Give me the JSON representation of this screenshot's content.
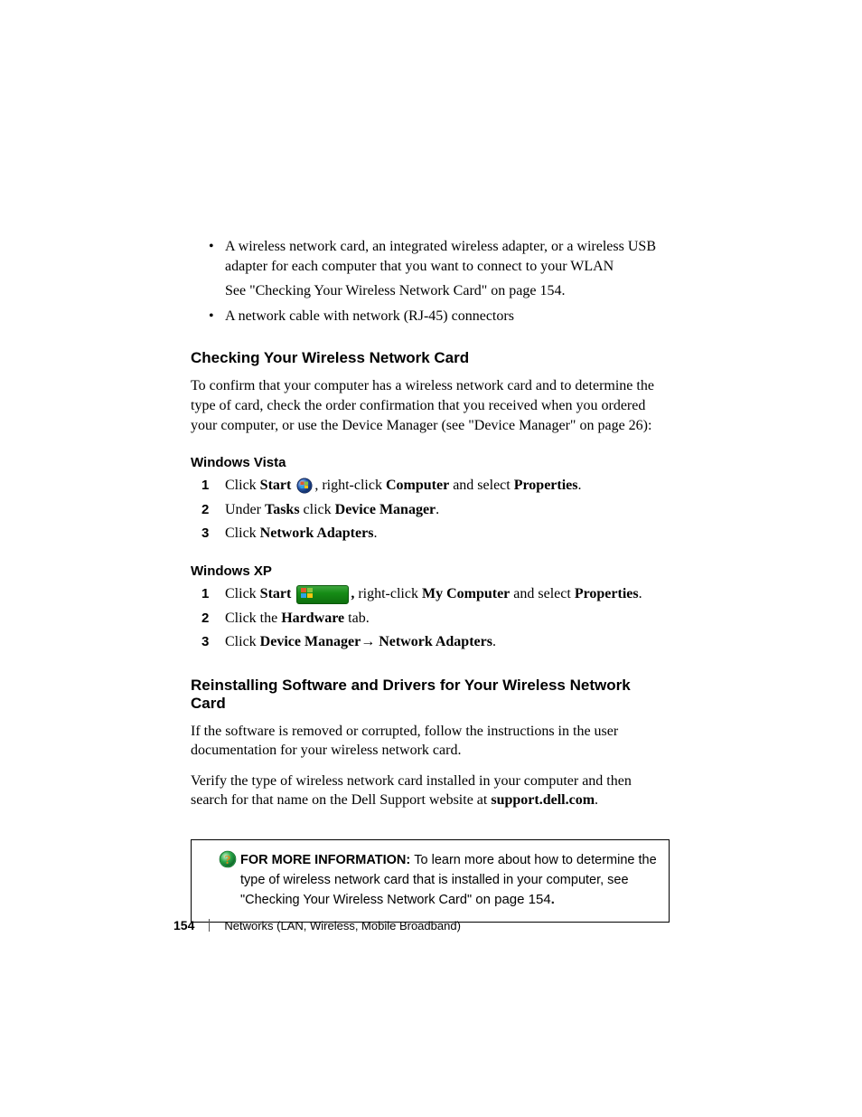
{
  "bullets": {
    "b1": "A wireless network card, an integrated wireless adapter, or a wireless USB adapter for each computer that you want to connect to your WLAN",
    "b1_sub": "See \"Checking Your Wireless Network Card\" on page 154.",
    "b2": "A network cable with network (RJ-45) connectors"
  },
  "section1": {
    "title": "Checking Your Wireless Network Card",
    "body": "To confirm that your computer has a wireless network card and to determine the type of card, check the order confirmation that you received when you ordered your computer, or use the Device Manager (see \"Device Manager\" on page 26):"
  },
  "vista": {
    "title": "Windows Vista",
    "steps": {
      "s1": {
        "num": "1",
        "pre": "Click ",
        "word_start": "Start ",
        "mid": ", right-click ",
        "word_comp": "Computer",
        "mid2": " and select ",
        "word_prop": "Properties",
        "end": "."
      },
      "s2": {
        "num": "2",
        "pre": "Under ",
        "word_tasks": "Tasks",
        "mid": " click ",
        "word_dm": "Device Manager",
        "end": "."
      },
      "s3": {
        "num": "3",
        "pre": "Click ",
        "word_na": "Network Adapters",
        "end": "."
      }
    }
  },
  "xp": {
    "title": "Windows XP",
    "steps": {
      "s1": {
        "num": "1",
        "pre": "Click ",
        "word_start": "Start ",
        "comma": ", ",
        "mid": "right-click ",
        "word_comp": "My Computer",
        "mid2": " and select ",
        "word_prop": "Properties",
        "end": "."
      },
      "s2": {
        "num": "2",
        "pre": "Click the ",
        "word_hw": "Hardware",
        "end": " tab."
      },
      "s3": {
        "num": "3",
        "pre": "Click ",
        "word_dm": "Device Manager",
        "arrow": "→ ",
        "word_na": "Network Adapters",
        "end": "."
      }
    }
  },
  "section2": {
    "title": "Reinstalling Software and Drivers for Your Wireless Network Card",
    "body1": "If the software is removed or corrupted, follow the instructions in the user documentation for your wireless network card.",
    "body2_pre": "Verify the type of wireless network card installed in your computer and then search for that name on the Dell Support website at ",
    "body2_bold": "support.dell.com",
    "body2_end": "."
  },
  "infobox": {
    "label": "FOR MORE INFORMATION: ",
    "text": "To learn more about how to determine the type of wireless network card that is installed in your computer, see \"Checking Your Wireless Network Card\"",
    "tail": " on page 154",
    "end": "."
  },
  "footer": {
    "page": "154",
    "chapter": "Networks (LAN, Wireless, Mobile Broadband)"
  }
}
